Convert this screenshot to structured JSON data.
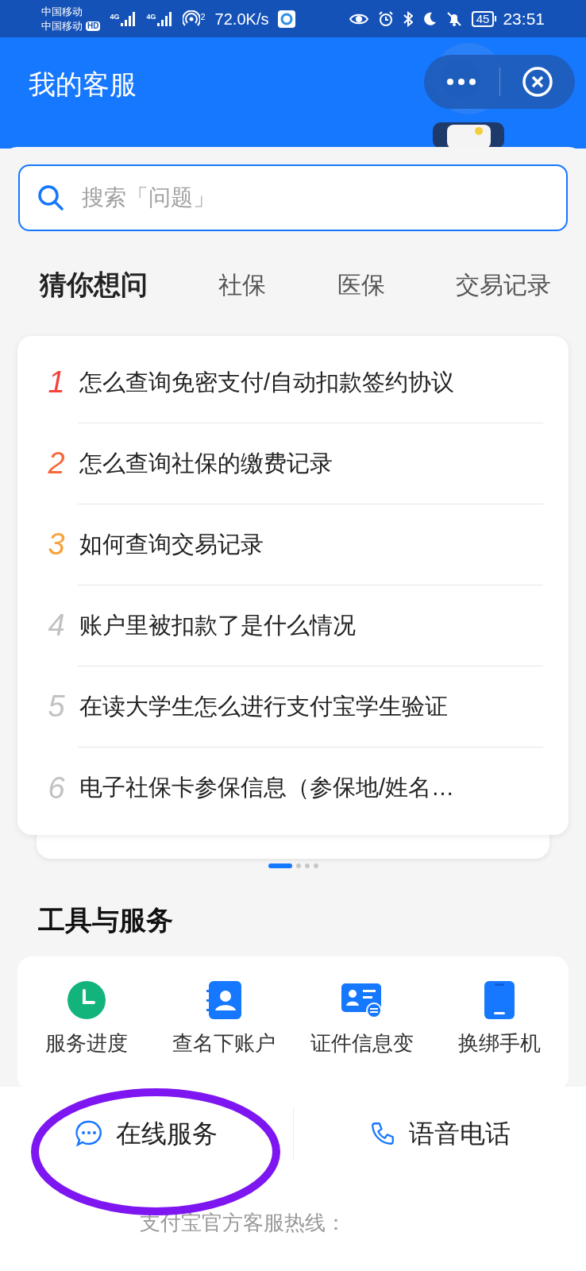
{
  "status_bar": {
    "carriers": [
      "中国移动",
      "中国移动"
    ],
    "hd": "HD",
    "network": [
      "4G",
      "4G"
    ],
    "hotspot": "2",
    "speed": "72.0K/s",
    "battery": "45",
    "time": "23:51"
  },
  "header": {
    "title": "我的客服"
  },
  "search": {
    "placeholder": "搜索「问题」"
  },
  "tabs": [
    {
      "label": "猜你想问",
      "selected": true
    },
    {
      "label": "社保",
      "selected": false
    },
    {
      "label": "医保",
      "selected": false
    },
    {
      "label": "交易记录",
      "selected": false
    }
  ],
  "questions": [
    {
      "rank": "1",
      "text": "怎么查询免密支付/自动扣款签约协议",
      "color": "#f5423b"
    },
    {
      "rank": "2",
      "text": "怎么查询社保的缴费记录",
      "color": "#f7683b"
    },
    {
      "rank": "3",
      "text": "如何查询交易记录",
      "color": "#f7a33b"
    },
    {
      "rank": "4",
      "text": "账户里被扣款了是什么情况",
      "color": "#c2c2c2"
    },
    {
      "rank": "5",
      "text": "在读大学生怎么进行支付宝学生验证",
      "color": "#c2c2c2"
    },
    {
      "rank": "6",
      "text": "电子社保卡参保信息（参保地/姓名…",
      "color": "#c2c2c2"
    }
  ],
  "pager": [
    {
      "selected": true
    },
    {
      "selected": false
    },
    {
      "selected": false
    },
    {
      "selected": false
    }
  ],
  "tools": {
    "title": "工具与服务",
    "items": [
      {
        "kind": "clock",
        "label": "服务进度"
      },
      {
        "kind": "contacts",
        "label": "查名下账户"
      },
      {
        "kind": "idcard",
        "label": "证件信息变"
      },
      {
        "kind": "phone",
        "label": "换绑手机"
      }
    ]
  },
  "bottom": {
    "buttons": [
      {
        "kind": "chat",
        "label": "在线服务",
        "circled": true
      },
      {
        "kind": "call",
        "label": "语音电话",
        "circled": false
      }
    ],
    "hotline": "支付宝官方客服热线："
  }
}
